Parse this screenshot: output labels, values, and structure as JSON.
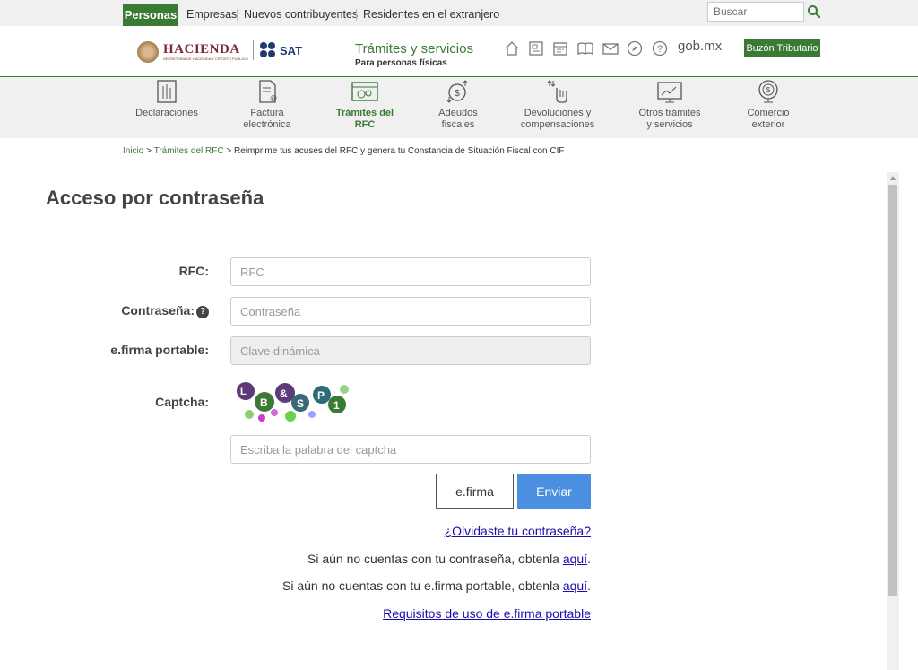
{
  "topbar": {
    "tabs": [
      "Personas",
      "Empresas",
      "Nuevos contribuyentes",
      "Residentes en el extranjero"
    ],
    "search_placeholder": "Buscar"
  },
  "header": {
    "hacienda_logo": "HACIENDA",
    "hacienda_sub": "SECRETARÍA DE HACIENDA Y CRÉDITO PÚBLICO",
    "sat_logo": "SAT",
    "title": "Trámites y servicios",
    "subtitle": "Para personas físicas",
    "icons": [
      "home-icon",
      "document-icon",
      "calendar-icon",
      "book-icon",
      "mail-icon",
      "compass-icon",
      "help-icon"
    ],
    "gob": "gob.mx",
    "buzon": "Buzón Tributario"
  },
  "nav": {
    "items": [
      {
        "line1": "Declaraciones",
        "line2": ""
      },
      {
        "line1": "Factura",
        "line2": "electrónica"
      },
      {
        "line1": "Trámites del",
        "line2": "RFC"
      },
      {
        "line1": "Adeudos",
        "line2": "fiscales"
      },
      {
        "line1": "Devoluciones y",
        "line2": "compensaciones"
      },
      {
        "line1": "Otros trámites",
        "line2": "y servicios"
      },
      {
        "line1": "Comercio",
        "line2": "exterior"
      }
    ],
    "active_index": 2
  },
  "breadcrumb": {
    "inicio": "Inicio",
    "sep": " > ",
    "rfc": "Trámites del RFC",
    "current": "Reimprime tus acuses del RFC y genera tu Constancia de Situación Fiscal con CIF"
  },
  "form": {
    "title": "Acceso por contraseña",
    "rfc_label": "RFC:",
    "rfc_placeholder": "RFC",
    "password_label": "Contraseña:",
    "password_placeholder": "Contraseña",
    "efirma_label": "e.firma portable:",
    "efirma_placeholder": "Clave dinámica",
    "captcha_label": "Captcha:",
    "captcha_text": "LB&SP1",
    "captcha_placeholder": "Escriba la palabra del captcha",
    "efirma_button": "e.firma",
    "submit_button": "Enviar",
    "forgot_link": "¿Olvidaste tu contraseña?",
    "no_password_text": "Si aún no cuentas con tu contraseña, obtenla ",
    "no_efirma_text": "Si aún no cuentas con tu e.firma portable, obtenla ",
    "aqui": "aquí",
    "period": ".",
    "requisitos_link": "Requisitos de uso de e.firma portable"
  },
  "colors": {
    "brand_green": "#3a7a35",
    "button_blue": "#4a8fe0",
    "hacienda_red": "#7a2a33",
    "sat_blue": "#1d3b6f"
  }
}
